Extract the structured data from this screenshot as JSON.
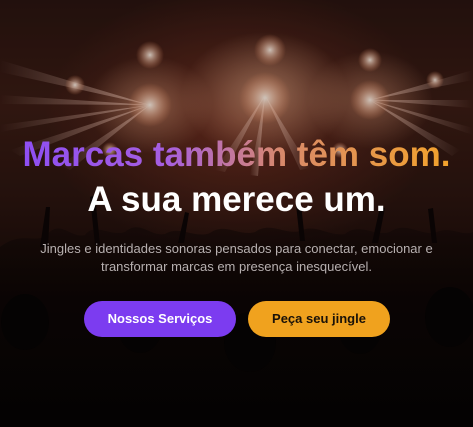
{
  "hero": {
    "headline_gradient": "Marcas também têm som.",
    "headline_white": "A sua merece um.",
    "subtitle": "Jingles e identidades sonoras pensados para conectar, emocionar e transformar marcas em presença inesquecível.",
    "background": "concert-crowd-stage-lights-image"
  },
  "buttons": {
    "primary_label": "Nossos Serviços",
    "secondary_label": "Peça seu jingle"
  },
  "colors": {
    "primary_purple": "#7c3cf0",
    "secondary_orange": "#f0a21e",
    "gradient_start": "#8a4cf5",
    "gradient_end": "#f6a623"
  }
}
